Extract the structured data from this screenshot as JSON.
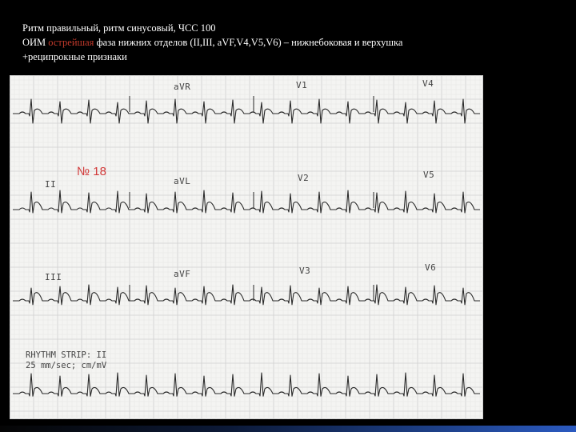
{
  "slide": {
    "line1": "Ритм правильный, ритм синусовый, ЧСС 100",
    "line2_prefix": "ОИМ ",
    "line2_accent": "острейшая",
    "line2_rest": " фаза нижних отделов  (II,III, aVF,V4,V5,V6) – нижнебоковая и верхушка",
    "line3": "+реципрокные признаки"
  },
  "ecg": {
    "case_number": "№ 18",
    "leads": {
      "avr": "aVR",
      "v1": "V1",
      "v4": "V4",
      "ii": "II",
      "avl": "aVL",
      "v2": "V2",
      "v5": "V5",
      "iii": "III",
      "avf": "aVF",
      "v3": "V3",
      "v6": "V6"
    },
    "rhythm_strip_line1": "RHYTHM STRIP: II",
    "rhythm_strip_line2": "25 mm/sec;   cm/mV"
  },
  "colors": {
    "background": "#000000",
    "text": "#ffffff",
    "accent": "#c0392b",
    "case_number": "#d23a3a",
    "paper": "#f4f4f2",
    "trace": "#2a2a2a"
  }
}
